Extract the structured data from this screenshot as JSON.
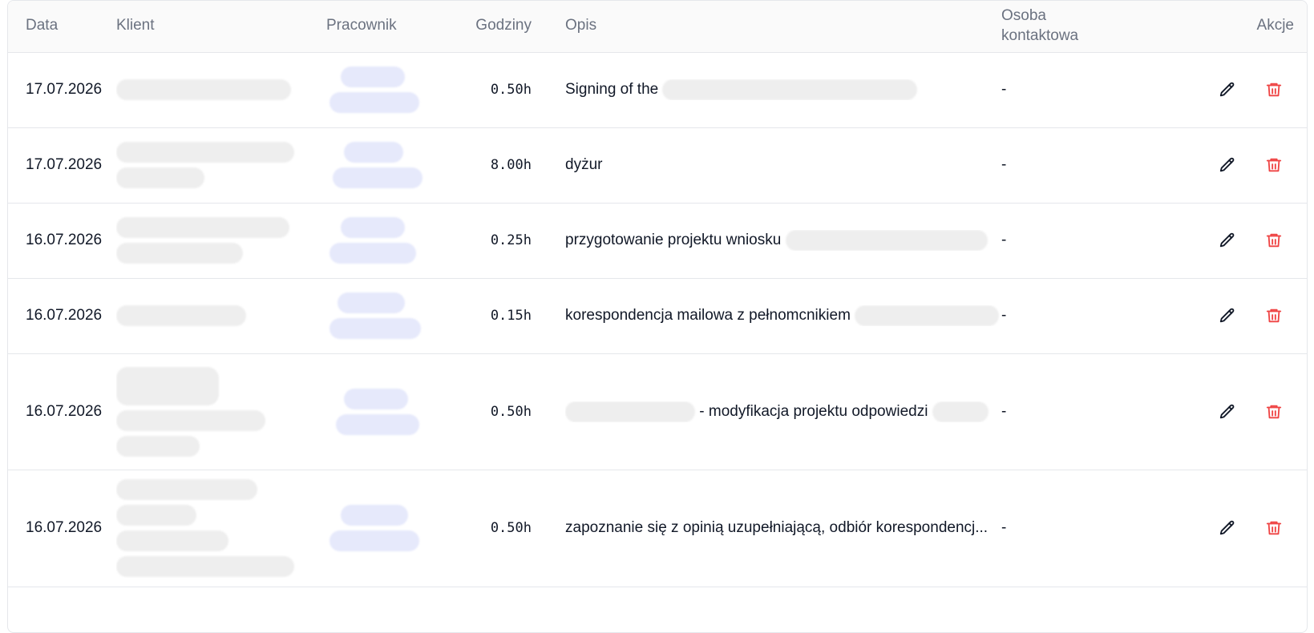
{
  "columns": {
    "date": "Data",
    "client": "Klient",
    "employee": "Pracownik",
    "hours": "Godziny",
    "description": "Opis",
    "contact": "Osoba kontaktowa",
    "actions": "Akcje"
  },
  "rows": [
    {
      "date": "17.07.2026",
      "hours": "0.50h",
      "description": "Signing of the",
      "contact": "-"
    },
    {
      "date": "17.07.2026",
      "hours": "8.00h",
      "description": "dyżur",
      "contact": "-"
    },
    {
      "date": "16.07.2026",
      "hours": "0.25h",
      "description": "przygotowanie projektu wniosku",
      "contact": "-"
    },
    {
      "date": "16.07.2026",
      "hours": "0.15h",
      "description": "korespondencja mailowa z pełnomcnikiem",
      "contact": "-"
    },
    {
      "date": "16.07.2026",
      "hours": "0.50h",
      "description": "- modyfikacja projektu odpowiedzi",
      "contact": "-"
    },
    {
      "date": "16.07.2026",
      "hours": "0.50h",
      "description": "zapoznanie się z opinią uzupełniającą, odbiór korespondencj...",
      "contact": "-"
    }
  ],
  "colors": {
    "edit_icon": "#111827",
    "delete_icon": "#ef4444",
    "header_text": "#6b7280",
    "border": "#e5e7eb"
  },
  "icons": {
    "edit": "pencil-icon",
    "delete": "trash-icon"
  }
}
